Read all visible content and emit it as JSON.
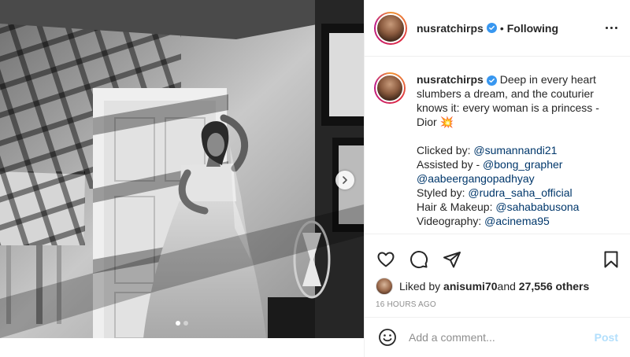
{
  "post": {
    "username": "nusratchirps",
    "follow_status": "Following",
    "separator": "•",
    "caption": {
      "line1": "Deep in every heart",
      "line2": "slumbers a dream, and the couturier",
      "line3": "knows it: every woman is a princess -",
      "line4": "Dior",
      "sparkle_emoji": "💥",
      "credits": [
        {
          "label": "Clicked by: ",
          "mention": "@sumannandi21"
        },
        {
          "label": "Assisted by - ",
          "mention": "@bong_grapher"
        },
        {
          "label": "",
          "mention": "@aabeergangopadhyay"
        },
        {
          "label": "Styled by: ",
          "mention": "@rudra_saha_official"
        },
        {
          "label": "Hair & Makeup: ",
          "mention": "@sahababusona"
        },
        {
          "label": "Videography: ",
          "mention": "@acinema95"
        }
      ]
    },
    "likes": {
      "prefix": "Liked by ",
      "user": "anisumi70",
      "middle": " and ",
      "count": "27,556 others"
    },
    "timestamp": "16 HOURS AGO",
    "comment": {
      "placeholder": "Add a comment...",
      "post_label": "Post"
    },
    "carousel": {
      "total": 2,
      "active_index": 0
    }
  },
  "icons": {
    "more": "more-options-icon",
    "verified": "verified-badge-icon",
    "like": "heart-icon",
    "comment": "comment-icon",
    "share": "share-icon",
    "save": "bookmark-icon",
    "emoji": "emoji-icon",
    "next": "chevron-right-icon"
  },
  "colors": {
    "link": "#00376b",
    "verified": "#3897f0",
    "post_disabled": "#b2dffc",
    "muted": "#8e8e8e"
  }
}
